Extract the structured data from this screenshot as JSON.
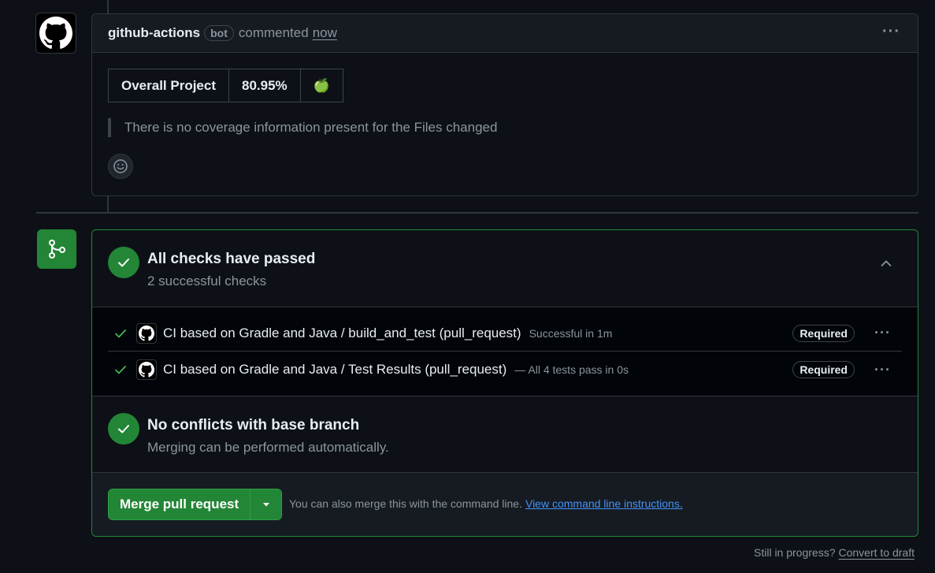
{
  "comment": {
    "author": "github-actions",
    "badge": "bot",
    "action": "commented",
    "time": "now",
    "coverage": {
      "label": "Overall Project",
      "value": "80.95%",
      "status_emoji": "🍏"
    },
    "quote": "There is no coverage information present for the Files changed"
  },
  "checks": {
    "title": "All checks have passed",
    "subtitle": "2 successful checks",
    "items": [
      {
        "name": "CI based on Gradle and Java / build_and_test (pull_request)",
        "detail": "Successful in 1m",
        "badge": "Required"
      },
      {
        "name": "CI based on Gradle and Java / Test Results (pull_request)",
        "detail": "— All 4 tests pass in 0s",
        "badge": "Required"
      }
    ]
  },
  "conflicts": {
    "title": "No conflicts with base branch",
    "subtitle": "Merging can be performed automatically."
  },
  "merge": {
    "button_label": "Merge pull request",
    "hint": "You can also merge this with the command line.",
    "link": "View command line instructions."
  },
  "footer": {
    "text": "Still in progress?",
    "link": "Convert to draft"
  },
  "colors": {
    "success": "#238636",
    "link": "#4493f8",
    "background": "#0d1117"
  }
}
